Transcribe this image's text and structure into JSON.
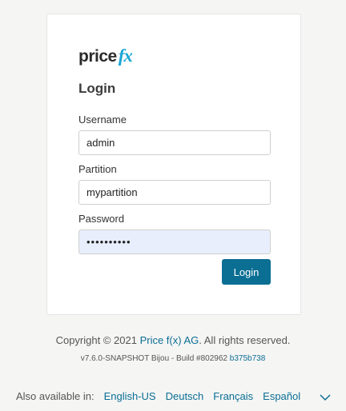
{
  "logo": {
    "price": "price",
    "fx": "fx"
  },
  "login": {
    "title": "Login",
    "username": {
      "label": "Username",
      "value": "admin"
    },
    "partition": {
      "label": "Partition",
      "value": "mypartition"
    },
    "password": {
      "label": "Password",
      "value": "••••••••••"
    },
    "button": "Login"
  },
  "footer": {
    "copyright_prefix": "Copyright © 2021 ",
    "company_link": "Price f(x) AG",
    "copyright_suffix": ". All rights reserved.",
    "build_text": "v7.6.0-SNAPSHOT Bijou - Build #802962 ",
    "build_hash": "b375b738",
    "also_available": "Also available in:",
    "languages": [
      "English-US",
      "Deutsch",
      "Français",
      "Español"
    ]
  },
  "colors": {
    "accent": "#0b6e93",
    "logo_fx": "#1aa6d6",
    "password_bg": "#e8eefb"
  },
  "icons": {
    "language_menu": "chevron-down-icon"
  }
}
